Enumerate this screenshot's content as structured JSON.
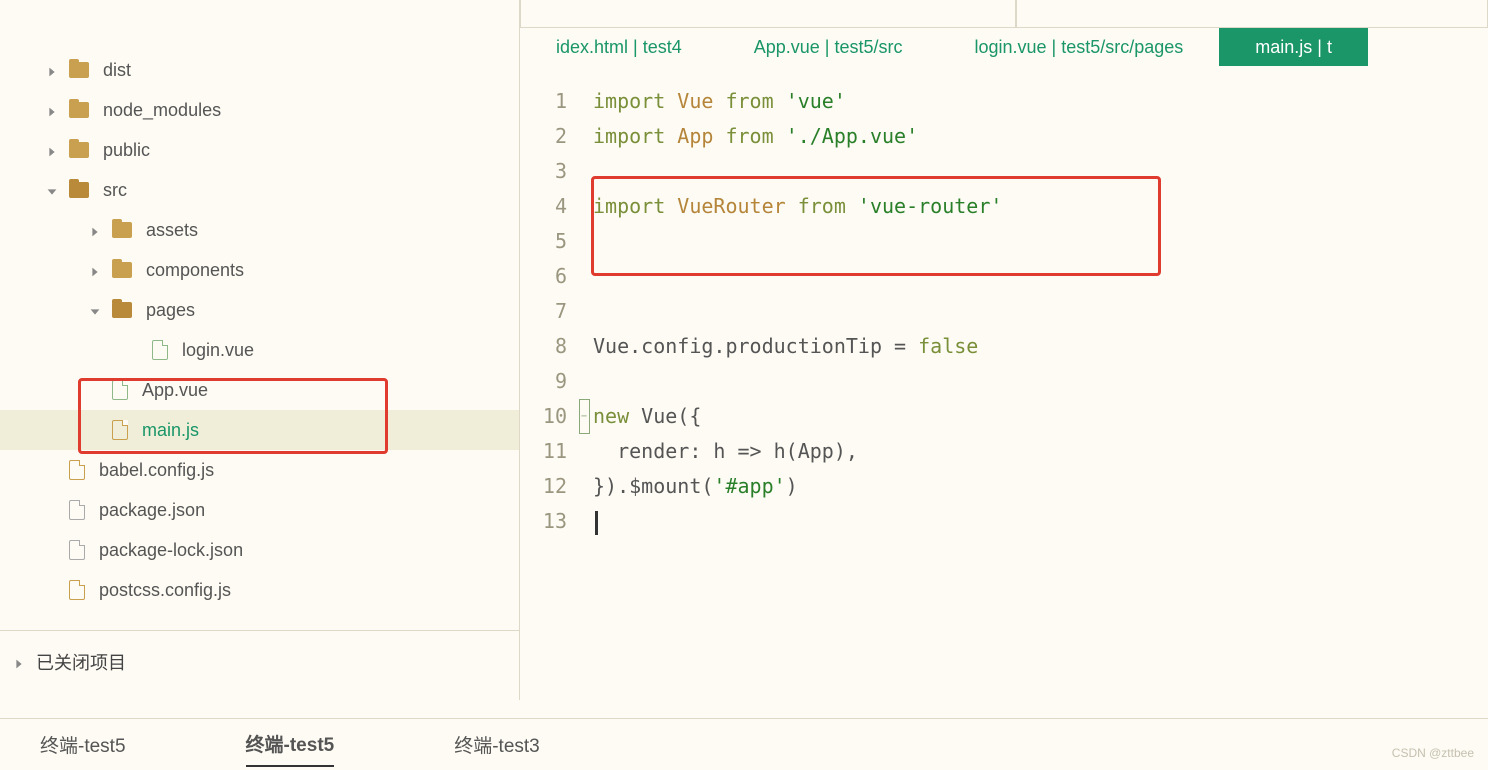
{
  "sidebar": {
    "items": [
      {
        "label": "dist"
      },
      {
        "label": "node_modules"
      },
      {
        "label": "public"
      },
      {
        "label": "src"
      },
      {
        "label": "assets"
      },
      {
        "label": "components"
      },
      {
        "label": "pages"
      },
      {
        "label": "login.vue"
      },
      {
        "label": "App.vue"
      },
      {
        "label": "main.js"
      },
      {
        "label": "babel.config.js"
      },
      {
        "label": "package.json"
      },
      {
        "label": "package-lock.json"
      },
      {
        "label": "postcss.config.js"
      }
    ],
    "closed_projects": "已关闭项目"
  },
  "tabs": [
    {
      "label": "idex.html | test4"
    },
    {
      "label": "App.vue | test5/src"
    },
    {
      "label": "login.vue | test5/src/pages"
    },
    {
      "label": "main.js | t"
    }
  ],
  "code": {
    "lines": [
      [
        {
          "t": "import",
          "c": "kw"
        },
        {
          "t": " Vue ",
          "c": "nm"
        },
        {
          "t": "from",
          "c": "kw"
        },
        {
          "t": " ",
          "c": "pl"
        },
        {
          "t": "'vue'",
          "c": "str"
        }
      ],
      [
        {
          "t": "import",
          "c": "kw"
        },
        {
          "t": " App ",
          "c": "nm"
        },
        {
          "t": "from",
          "c": "kw"
        },
        {
          "t": " ",
          "c": "pl"
        },
        {
          "t": "'./App.vue'",
          "c": "str"
        }
      ],
      [],
      [
        {
          "t": "import",
          "c": "kw"
        },
        {
          "t": " VueRouter ",
          "c": "nm"
        },
        {
          "t": "from",
          "c": "kw"
        },
        {
          "t": " ",
          "c": "pl"
        },
        {
          "t": "'vue-router'",
          "c": "str"
        }
      ],
      [],
      [],
      [],
      [
        {
          "t": "Vue.config.productionTip = ",
          "c": "pl"
        },
        {
          "t": "false",
          "c": "kw"
        }
      ],
      [],
      [
        {
          "t": "new",
          "c": "kw"
        },
        {
          "t": " Vue({",
          "c": "pl"
        }
      ],
      [
        {
          "t": "  render: h => h(App),",
          "c": "pl"
        }
      ],
      [
        {
          "t": "}).$mount(",
          "c": "pl"
        },
        {
          "t": "'#app'",
          "c": "str"
        },
        {
          "t": ")",
          "c": "pl"
        }
      ],
      []
    ],
    "line_numbers": [
      "1",
      "2",
      "3",
      "4",
      "5",
      "6",
      "7",
      "8",
      "9",
      "10",
      "11",
      "12",
      "13"
    ]
  },
  "bottom_tabs": [
    {
      "label": "终端-test5"
    },
    {
      "label": "终端-test5"
    },
    {
      "label": "终端-test3"
    }
  ],
  "watermark": "CSDN @zttbee"
}
